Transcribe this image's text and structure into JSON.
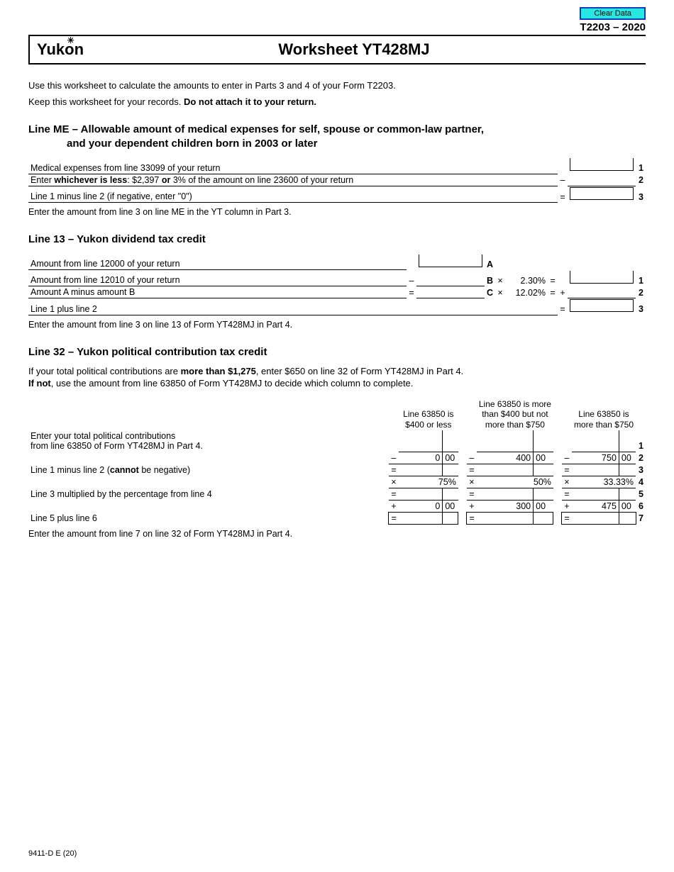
{
  "top": {
    "clear": "Clear Data",
    "form_code": "T2203 – 2020"
  },
  "logo": "Yukon",
  "title": "Worksheet YT428MJ",
  "intro1": "Use this worksheet to calculate the amounts to enter in Parts 3 and 4 of your Form T2203.",
  "intro2a": "Keep this worksheet for your records. ",
  "intro2b": "Do not attach it to your return.",
  "sec_me": {
    "h1": "Line ME – Allowable amount of medical expenses for self, spouse or common-law partner,",
    "h2": "and your dependent children born in 2003 or later",
    "r1": "Medical expenses from line 33099 of your return",
    "r2a": "Enter ",
    "r2b": "whichever is less",
    "r2c": ": $2,397 ",
    "r2d": "or",
    "r2e": " 3% of the amount on line 23600 of your return",
    "r3": "Line 1 minus line 2 (if negative, enter \"0\")",
    "note": "Enter the amount from line 3 on line ME in the YT column in Part 3."
  },
  "sec_13": {
    "h": "Line 13 – Yukon dividend tax credit",
    "r1": "Amount from line 12000 of your return",
    "r2": "Amount from line 12010 of your return",
    "r3": "Amount A minus amount B",
    "r4": "Line 1 plus line 2",
    "pct1": "2.30%",
    "pct2": "12.02%",
    "note": "Enter the amount from line 3 on line 13 of Form YT428MJ in Part 4."
  },
  "sec_32": {
    "h": "Line 32 – Yukon political contribution tax credit",
    "p1a": "If your total political contributions are ",
    "p1b": "more than $1,275",
    "p1c": ", enter $650 on line 32 of Form YT428MJ in Part 4.",
    "p2a": "If not",
    "p2b": ", use the amount from line 63850 of Form YT428MJ to decide which column to complete.",
    "col1a": "Line 63850 is",
    "col1b": "$400 or less",
    "col2a": "Line 63850 is more",
    "col2b": "than $400 but not",
    "col2c": "more than $750",
    "col3a": "Line 63850 is",
    "col3b": "more than $750",
    "r1a": "Enter your total political contributions",
    "r1b": "from line 63850 of Form YT428MJ in Part 4.",
    "r3a": "Line 1 minus line 2 (",
    "r3b": "cannot",
    "r3c": " be negative)",
    "r5": "Line 3 multiplied by the percentage from line 4",
    "r7": "Line 5 plus line 6",
    "v2_1d": "0",
    "v2_1c": "00",
    "v2_2d": "400",
    "v2_2c": "00",
    "v2_3d": "750",
    "v2_3c": "00",
    "v4_1": "75%",
    "v4_2": "50%",
    "v4_3": "33.33%",
    "v6_1d": "0",
    "v6_1c": "00",
    "v6_2d": "300",
    "v6_2c": "00",
    "v6_3d": "475",
    "v6_3c": "00",
    "note": "Enter the amount from line 7 on line 32 of Form YT428MJ in Part 4."
  },
  "footer": "9411-D E (20)",
  "ops": {
    "minus": "–",
    "eq": "=",
    "plus": "+",
    "times": "×"
  },
  "labels": {
    "A": "A",
    "B": "B",
    "C": "C",
    "n1": "1",
    "n2": "2",
    "n3": "3",
    "n4": "4",
    "n5": "5",
    "n6": "6",
    "n7": "7"
  }
}
